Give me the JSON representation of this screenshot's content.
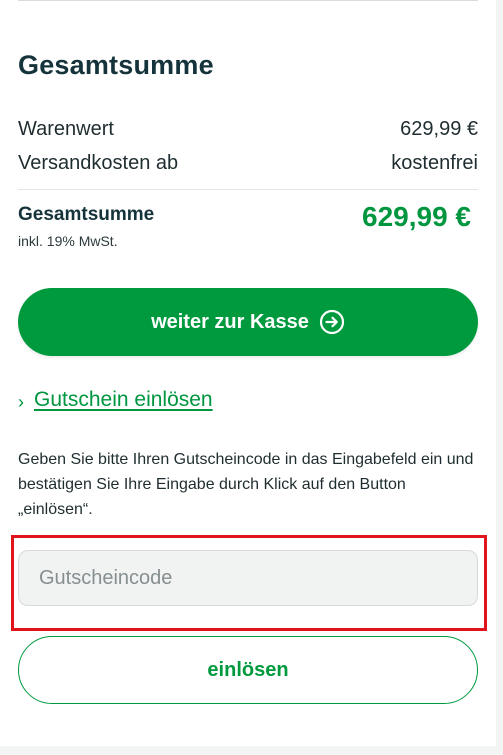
{
  "summary": {
    "heading": "Gesamtsumme",
    "rows": [
      {
        "label": "Warenwert",
        "value": "629,99 €"
      },
      {
        "label": "Versandkosten ab",
        "value": "kostenfrei"
      }
    ],
    "total_label": "Gesamtsumme",
    "total_value": "629,99 €",
    "vat_note": "inkl. 19% MwSt."
  },
  "checkout": {
    "label": "weiter zur Kasse",
    "icon": "arrow-right-circle-icon"
  },
  "voucher": {
    "toggle_label": "Gutschein einlösen",
    "toggle_icon": "chevron-right-icon",
    "instructions": "Geben Sie bitte Ihren Gutscheincode in das Eingabefeld ein und bestätigen Sie Ihre Eingabe durch Klick auf den Button „einlösen“.",
    "input_value": "",
    "input_placeholder": "Gutscheincode",
    "redeem_label": "einlösen"
  },
  "colors": {
    "brand_green": "#009a3e",
    "highlight_red": "#e0141b",
    "heading_text": "#15333a"
  }
}
